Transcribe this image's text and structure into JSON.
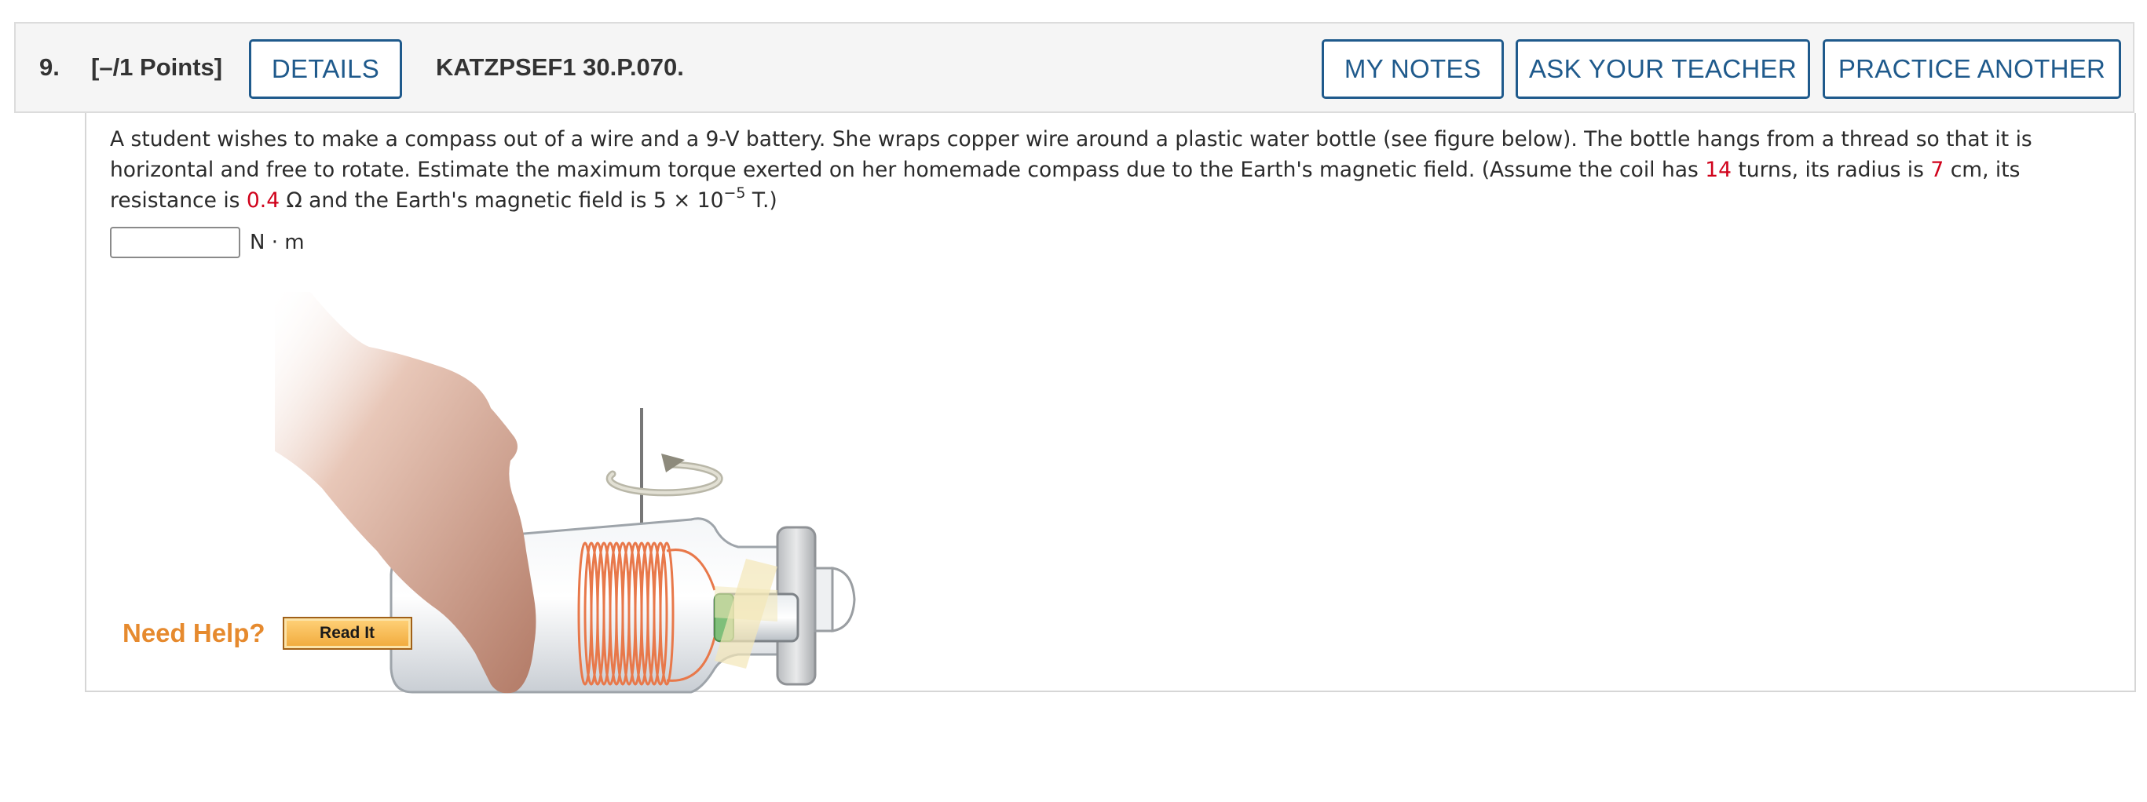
{
  "header": {
    "question_number": "9.",
    "points": "[–/1 Points]",
    "details_label": "DETAILS",
    "question_code": "KATZPSEF1 30.P.070.",
    "my_notes_label": "MY NOTES",
    "ask_teacher_label": "ASK YOUR TEACHER",
    "practice_another_label": "PRACTICE ANOTHER"
  },
  "question": {
    "text_part1": "A student wishes to make a compass out of a wire and a 9-V battery. She wraps copper wire around a plastic water bottle (see figure below). The bottle hangs from a thread so that it is horizontal and free to rotate. Estimate the maximum torque exerted on her homemade compass due to the Earth's magnetic field. (Assume the coil has ",
    "turns": "14",
    "text_part2": " turns, its radius is ",
    "radius": "7",
    "text_part3": " cm, its resistance is ",
    "resistance": "0.4",
    "text_part4": " Ω and the Earth's magnetic field is 5 × 10",
    "exponent": "−5",
    "text_part5": " T.)"
  },
  "answer": {
    "value": "",
    "unit": "N · m"
  },
  "figure": {
    "icon": "bottle-compass-figure"
  },
  "help": {
    "need_help_label": "Need Help?",
    "read_it_label": "Read It"
  },
  "colors": {
    "accent_blue": "#1f5a8c",
    "given_value_red": "#d0021b",
    "help_orange": "#e68a2e",
    "copper_wire": "#e8784a"
  }
}
